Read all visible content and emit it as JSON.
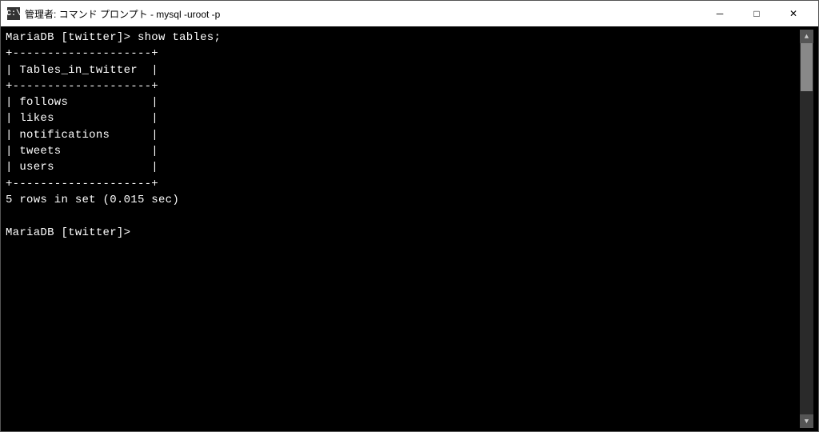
{
  "titlebar": {
    "icon_label": "C:\\",
    "title": "管理者: コマンド プロンプト - mysql  -uroot -p",
    "minimize_label": "─",
    "maximize_label": "□",
    "close_label": "✕"
  },
  "terminal": {
    "content_lines": [
      "MariaDB [twitter]> show tables;",
      "+--------------------+",
      "| Tables_in_twitter  |",
      "+--------------------+",
      "| follows            |",
      "| likes              |",
      "| notifications      |",
      "| tweets             |",
      "| users              |",
      "+--------------------+",
      "5 rows in set (0.015 sec)",
      "",
      "MariaDB [twitter]> "
    ]
  }
}
